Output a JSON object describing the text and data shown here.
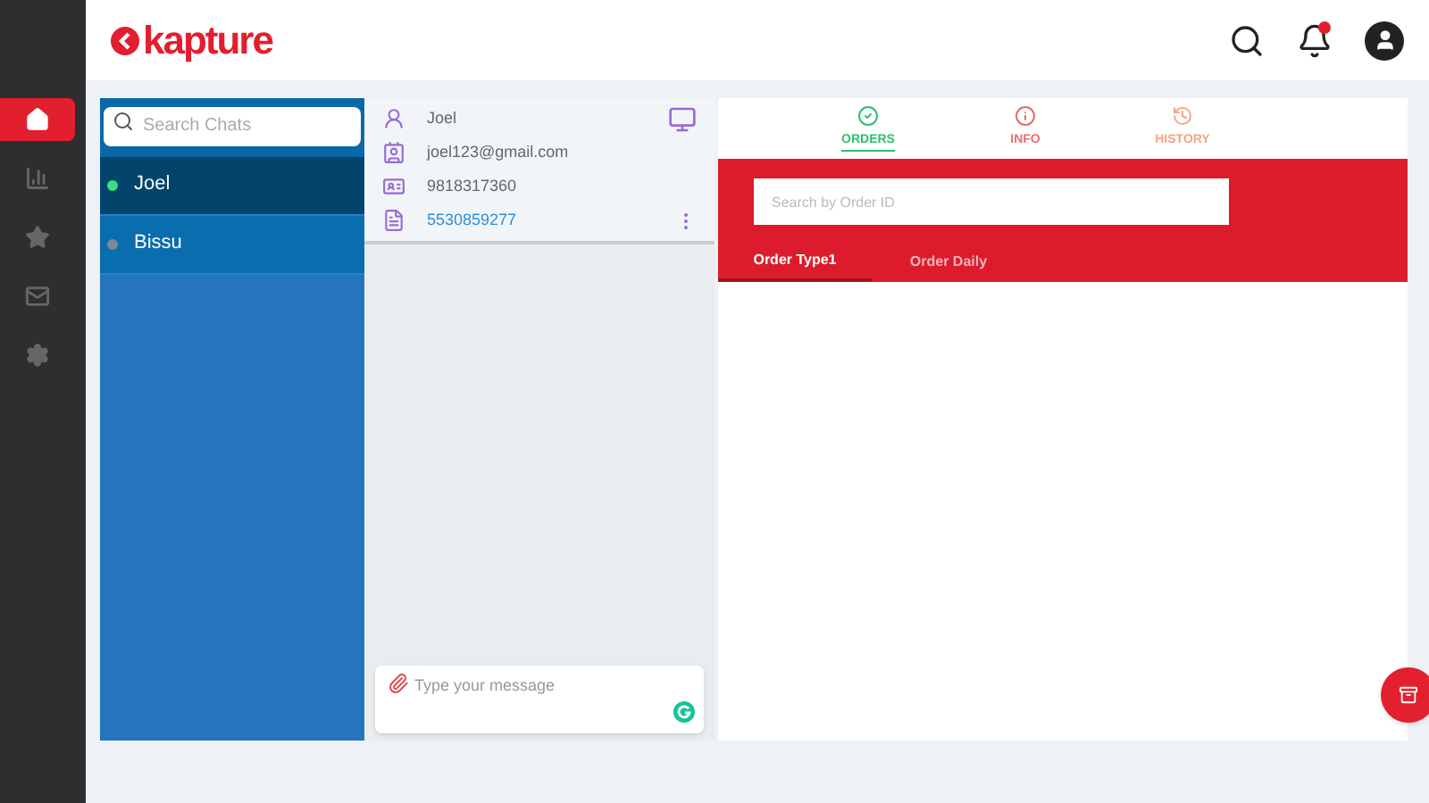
{
  "logo": {
    "text": "kapture"
  },
  "nav": [
    {
      "kind": "home",
      "selected": true
    },
    {
      "kind": "chart",
      "selected": false
    },
    {
      "kind": "star",
      "selected": false
    },
    {
      "kind": "mail",
      "selected": false
    },
    {
      "kind": "settings",
      "selected": false
    }
  ],
  "chats": {
    "search": {
      "placeholder": "Search Chats"
    },
    "items": [
      {
        "name": "Joel",
        "selected": true,
        "color": "#3ddc84"
      },
      {
        "name": "Bissu",
        "selected": false,
        "color": "#7a8a99"
      }
    ]
  },
  "contact": [
    {
      "kind": "person",
      "text": "Joel"
    },
    {
      "kind": "email",
      "text": "joel123@gmail.com"
    },
    {
      "kind": "phone",
      "text": "9818317360"
    },
    {
      "kind": "ticket",
      "text": "5530859277"
    }
  ],
  "composer": {
    "placeholder": "Type your message"
  },
  "tabs": [
    {
      "kind": "orders",
      "label": "ORDERS",
      "selected": true
    },
    {
      "kind": "info",
      "label": "INFO",
      "selected": false
    },
    {
      "kind": "history",
      "label": "HISTORY",
      "selected": false
    }
  ],
  "order_search": {
    "placeholder": "Search by Order ID"
  },
  "subtabs": [
    {
      "label": "Order Type1",
      "selected": true
    },
    {
      "label": "Order Daily",
      "selected": false
    }
  ]
}
